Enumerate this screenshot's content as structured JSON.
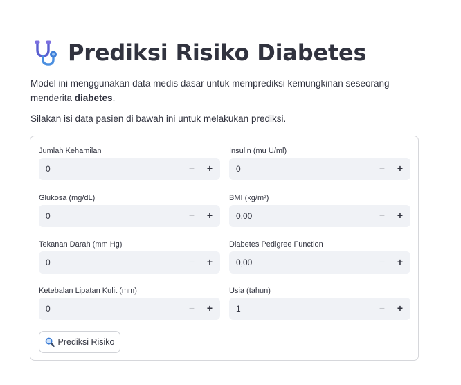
{
  "header": {
    "title": "Prediksi Risiko Diabetes",
    "icon": "stethoscope-icon"
  },
  "intro": {
    "text_before": "Model ini menggunakan data medis dasar untuk memprediksi kemungkinan seseorang menderita ",
    "bold": "diabetes",
    "text_after": "."
  },
  "instruction": "Silakan isi data pasien di bawah ini untuk melakukan prediksi.",
  "form": {
    "fields": [
      {
        "label": "Jumlah Kehamilan",
        "value": "0"
      },
      {
        "label": "Insulin (mu U/ml)",
        "value": "0"
      },
      {
        "label": "Glukosa (mg/dL)",
        "value": "0"
      },
      {
        "label": "BMI (kg/m²)",
        "value": "0,00"
      },
      {
        "label": "Tekanan Darah (mm Hg)",
        "value": "0"
      },
      {
        "label": "Diabetes Pedigree Function",
        "value": "0,00"
      },
      {
        "label": "Ketebalan Lipatan Kulit (mm)",
        "value": "0"
      },
      {
        "label": "Usia (tahun)",
        "value": "1"
      }
    ],
    "stepper": {
      "minus": "−",
      "plus": "+"
    },
    "submit_label": "Prediksi Risiko",
    "submit_icon": "magnifier-icon"
  },
  "colors": {
    "text": "#31333f",
    "input_bg": "#f0f2f6",
    "border": "#d6d7db",
    "icon_accent": "#6c63d8"
  }
}
